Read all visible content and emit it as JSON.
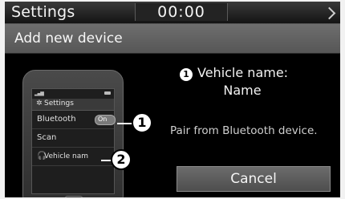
{
  "status_bar": {
    "app_title": "Settings",
    "clock": "00:00"
  },
  "title_bar": {
    "title": "Add new device"
  },
  "phone_illustration": {
    "settings_label": "Settings",
    "rows": [
      {
        "label": "Bluetooth",
        "toggle": "On"
      },
      {
        "label": "Scan"
      },
      {
        "label": "Vehicle nam"
      }
    ]
  },
  "callouts": [
    "1",
    "2"
  ],
  "info": {
    "badge": "1",
    "vehicle_name_label": "Vehicle name:",
    "vehicle_name_value": "Name",
    "instruction": "Pair from Bluetooth device."
  },
  "buttons": {
    "cancel": "Cancel"
  },
  "icons": {
    "settings": "gear-icon",
    "vehicle": "headset-icon",
    "status": "chevron-icon"
  }
}
